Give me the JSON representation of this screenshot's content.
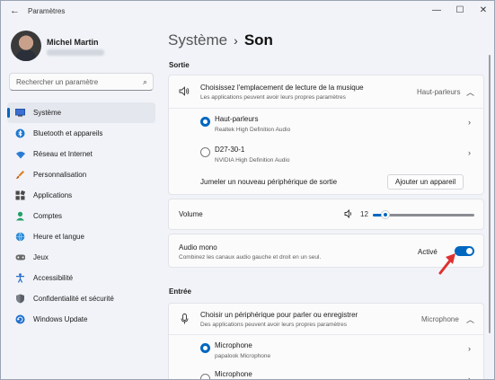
{
  "app": {
    "title": "Paramètres"
  },
  "user": {
    "name": "Michel Martin"
  },
  "search": {
    "placeholder": "Rechercher un paramètre"
  },
  "sidebar": {
    "items": [
      {
        "label": "Système",
        "icon": "system-icon",
        "active": true
      },
      {
        "label": "Bluetooth et appareils",
        "icon": "bluetooth-icon"
      },
      {
        "label": "Réseau et Internet",
        "icon": "wifi-icon"
      },
      {
        "label": "Personnalisation",
        "icon": "brush-icon"
      },
      {
        "label": "Applications",
        "icon": "apps-icon"
      },
      {
        "label": "Comptes",
        "icon": "person-icon"
      },
      {
        "label": "Heure et langue",
        "icon": "globe-icon"
      },
      {
        "label": "Jeux",
        "icon": "gamepad-icon"
      },
      {
        "label": "Accessibilité",
        "icon": "accessibility-icon"
      },
      {
        "label": "Confidentialité et sécurité",
        "icon": "shield-icon"
      },
      {
        "label": "Windows Update",
        "icon": "update-icon"
      }
    ]
  },
  "breadcrumb": {
    "parent": "Système",
    "separator": "›",
    "current": "Son"
  },
  "output": {
    "section": "Sortie",
    "header": {
      "title": "Choisissez l'emplacement de lecture de la musique",
      "subtitle": "Les applications peuvent avoir leurs propres paramètres",
      "value": "Haut-parleurs"
    },
    "devices": [
      {
        "name": "Haut-parleurs",
        "desc": "Realtek High Definition Audio",
        "selected": true
      },
      {
        "name": "D27-30-1",
        "desc": "NVIDIA High Definition Audio",
        "selected": false
      }
    ],
    "pair": {
      "label": "Jumeler un nouveau périphérique de sortie",
      "button": "Ajouter un appareil"
    },
    "volume": {
      "label": "Volume",
      "value": "12",
      "level": 0.12
    },
    "mono": {
      "title": "Audio mono",
      "subtitle": "Combinez les canaux audio gauche et droit en un seul.",
      "state": "Activé",
      "on": true
    }
  },
  "input": {
    "section": "Entrée",
    "header": {
      "title": "Choisir un périphérique pour parler ou enregistrer",
      "subtitle": "Des applications peuvent avoir leurs propres paramètres",
      "value": "Microphone"
    },
    "devices": [
      {
        "name": "Microphone",
        "desc": "papalook Microphone",
        "selected": true
      },
      {
        "name": "Microphone",
        "desc": "",
        "selected": false
      }
    ]
  },
  "colors": {
    "accent": "#0067c0",
    "annotation_arrow": "#e03030"
  }
}
